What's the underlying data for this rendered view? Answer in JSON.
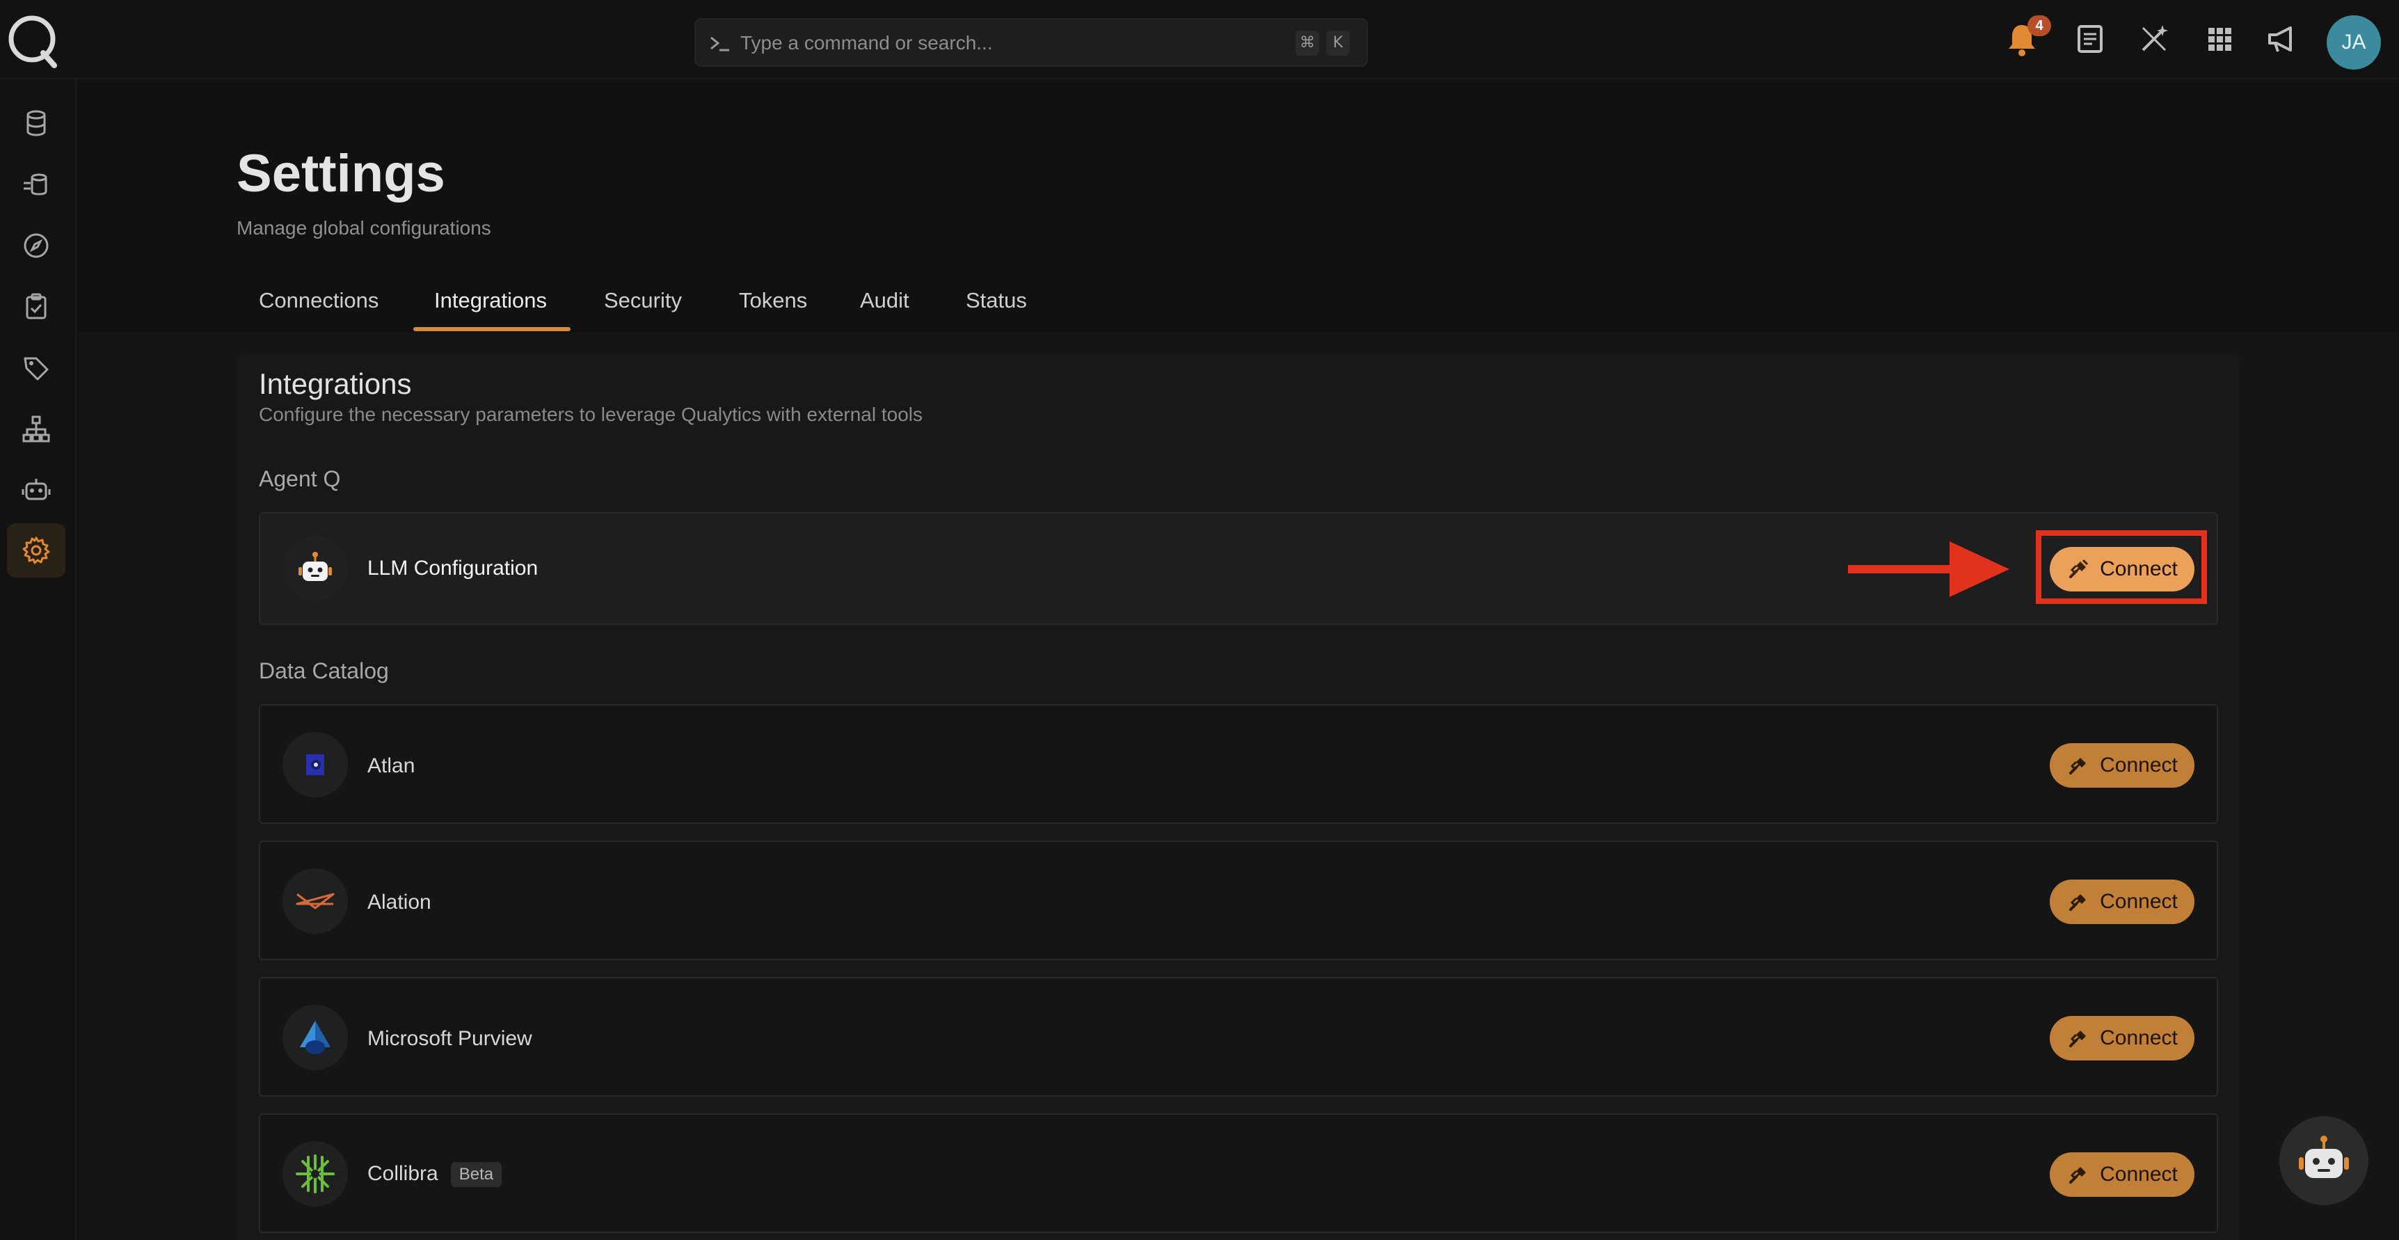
{
  "search": {
    "placeholder": "Type a command or search...",
    "shortcut_mod": "⌘",
    "shortcut_key": "K"
  },
  "header": {
    "notification_count": "4",
    "avatar_initials": "JA"
  },
  "page": {
    "title": "Settings",
    "subtitle": "Manage global configurations"
  },
  "tabs": [
    {
      "label": "Connections"
    },
    {
      "label": "Integrations",
      "active": true
    },
    {
      "label": "Security"
    },
    {
      "label": "Tokens"
    },
    {
      "label": "Audit"
    },
    {
      "label": "Status"
    }
  ],
  "panel": {
    "title": "Integrations",
    "description": "Configure the necessary parameters to leverage Qualytics with external tools"
  },
  "sections": {
    "agent_q": "Agent Q",
    "data_catalog": "Data Catalog"
  },
  "integrations": {
    "llm": {
      "name": "LLM Configuration",
      "action": "Connect"
    },
    "atlan": {
      "name": "Atlan",
      "action": "Connect"
    },
    "alation": {
      "name": "Alation",
      "action": "Connect"
    },
    "purview": {
      "name": "Microsoft Purview",
      "action": "Connect"
    },
    "collibra": {
      "name": "Collibra",
      "badge": "Beta",
      "action": "Connect"
    }
  },
  "colors": {
    "accent": "#eaa15a",
    "annotation": "#e3321c",
    "avatar": "#3b8a9d"
  }
}
